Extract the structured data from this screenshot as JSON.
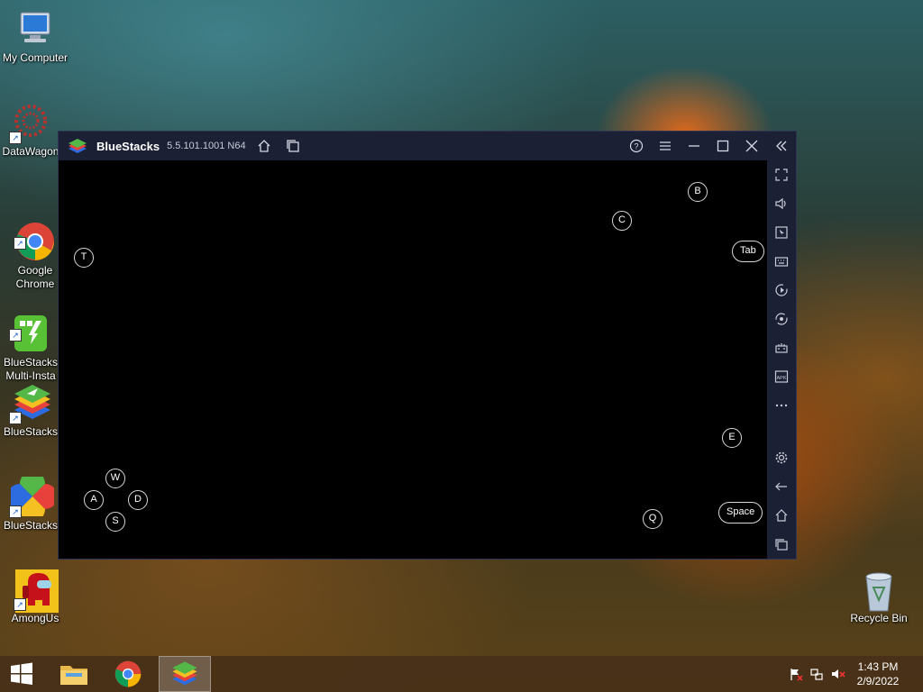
{
  "desktop": {
    "icons": [
      {
        "label": "My Computer",
        "icon": "computer-icon"
      },
      {
        "label": "DataWagon",
        "icon": "datawagon-icon"
      },
      {
        "label": "Google\nChrome",
        "icon": "chrome-icon"
      },
      {
        "label": "BlueStacks\nMulti-Insta",
        "icon": "bluestacks-multi-instance-icon"
      },
      {
        "label": "BlueStacks",
        "icon": "bluestacks-icon"
      },
      {
        "label": "BlueStacks",
        "icon": "bluestacks-x-icon"
      },
      {
        "label": "AmongUs",
        "icon": "amongus-icon"
      },
      {
        "label": "Recycle Bin",
        "icon": "recycle-bin-icon"
      }
    ]
  },
  "window": {
    "title": "BlueStacks",
    "version": "5.5.101.1001 N64",
    "titlebar_buttons": [
      "home-icon",
      "multi-instance-icon",
      "help-icon",
      "menu-icon",
      "minimize-icon",
      "maximize-icon",
      "close-icon",
      "collapse-sidebar-icon"
    ],
    "sidebar_buttons": [
      "fullscreen-icon",
      "volume-icon",
      "pointer-icon",
      "keyboard-icon",
      "macro-icon",
      "rotate-icon",
      "gamepad-icon",
      "apk-icon",
      "more-icon",
      "settings-icon",
      "back-icon",
      "home-icon",
      "recent-apps-icon"
    ],
    "keys": {
      "b": "B",
      "c": "C",
      "tab": "Tab",
      "t": "T",
      "e": "E",
      "w": "W",
      "a": "A",
      "d": "D",
      "s": "S",
      "q": "Q",
      "space": "Space"
    }
  },
  "taskbar": {
    "items": [
      "start-icon",
      "file-explorer-icon",
      "chrome-icon",
      "bluestacks-icon"
    ],
    "tray": [
      "action-center-flag-icon",
      "network-icon",
      "volume-muted-icon"
    ],
    "time": "1:43 PM",
    "date": "2/9/2022"
  },
  "colors": {
    "titlebar": "#1b2035",
    "sidebar": "#1b2035",
    "key_border": "#d8d8d8"
  }
}
